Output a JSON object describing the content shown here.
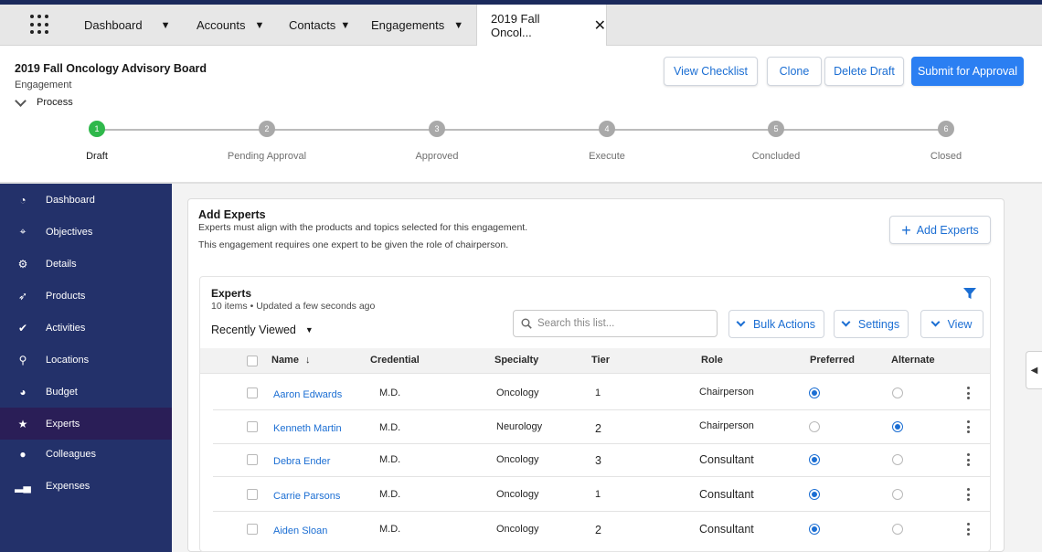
{
  "nav": {
    "tabs": [
      {
        "label": "Dashboard"
      },
      {
        "label": "Accounts"
      },
      {
        "label": "Contacts"
      },
      {
        "label": "Engagements"
      }
    ],
    "active_tab": "2019 Fall Oncol...",
    "icons": {
      "launcher": "app-launcher-icon",
      "caret": "caret-down-icon",
      "close": "close-icon"
    }
  },
  "header": {
    "title": "2019 Fall Oncology Advisory Board",
    "object_type": "Engagement",
    "buttons": {
      "view_checklist": "View Checklist",
      "clone": "Clone",
      "delete_draft": "Delete Draft",
      "submit": "Submit for Approval"
    },
    "process_label": "Process",
    "steps": [
      {
        "num": "1",
        "label": "Draft",
        "status": "current"
      },
      {
        "num": "2",
        "label": "Pending Approval",
        "status": "pending"
      },
      {
        "num": "3",
        "label": "Approved",
        "status": "pending"
      },
      {
        "num": "4",
        "label": "Execute",
        "status": "pending"
      },
      {
        "num": "5",
        "label": "Concluded",
        "status": "pending"
      },
      {
        "num": "6",
        "label": "Closed",
        "status": "pending"
      }
    ]
  },
  "sidebar": {
    "items": [
      {
        "label": "Dashboard",
        "icon": "dashboard-icon"
      },
      {
        "label": "Objectives",
        "icon": "objectives-icon"
      },
      {
        "label": "Details",
        "icon": "gear-icon"
      },
      {
        "label": "Products",
        "icon": "rocket-icon"
      },
      {
        "label": "Activities",
        "icon": "check-circle-icon"
      },
      {
        "label": "Locations",
        "icon": "location-pin-icon"
      },
      {
        "label": "Budget",
        "icon": "pie-chart-icon"
      },
      {
        "label": "Experts",
        "icon": "star-icon",
        "active": true
      },
      {
        "label": "Colleagues",
        "icon": "person-icon"
      },
      {
        "label": "Expenses",
        "icon": "bar-chart-icon"
      }
    ]
  },
  "add_experts": {
    "title": "Add Experts",
    "desc1": "Experts must align with the products and topics selected for this engagement.",
    "desc2": "This engagement requires one expert to be given the role of chairperson.",
    "button": "Add Experts"
  },
  "experts": {
    "title": "Experts",
    "meta": "10 items • Updated a few seconds ago",
    "list_view": "Recently Viewed",
    "search_placeholder": "Search this list...",
    "bulk_actions": "Bulk Actions",
    "settings": "Settings",
    "view": "View",
    "columns": {
      "name": "Name",
      "credential": "Credential",
      "specialty": "Specialty",
      "tier": "Tier",
      "role": "Role",
      "preferred": "Preferred",
      "alternate": "Alternate"
    },
    "rows": [
      {
        "name": "Aaron Edwards",
        "credential": "M.D.",
        "specialty": "Oncology",
        "tier": "1",
        "role": "Chairperson",
        "preferred": true,
        "alternate": false
      },
      {
        "name": "Kenneth Martin",
        "credential": "M.D.",
        "specialty": "Neurology",
        "tier": "2",
        "role": "Chairperson",
        "preferred": false,
        "alternate": true
      },
      {
        "name": "Debra Ender",
        "credential": "M.D.",
        "specialty": "Oncology",
        "tier": "3",
        "role": "Consultant",
        "preferred": true,
        "alternate": false
      },
      {
        "name": "Carrie Parsons",
        "credential": "M.D.",
        "specialty": "Oncology",
        "tier": "1",
        "role": "Consultant",
        "preferred": true,
        "alternate": false
      },
      {
        "name": "Aiden Sloan",
        "credential": "M.D.",
        "specialty": "Oncology",
        "tier": "2",
        "role": "Consultant",
        "preferred": true,
        "alternate": false
      }
    ]
  },
  "colors": {
    "accent": "#1b6ed3",
    "sidebar": "#23316a",
    "sidebar_active": "#2a1e57",
    "step_done": "#2fb84b"
  }
}
